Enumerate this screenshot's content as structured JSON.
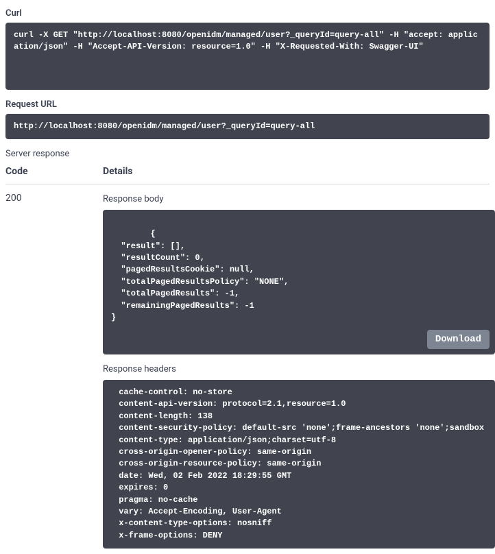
{
  "curl": {
    "label": "Curl",
    "command": "curl -X GET \"http://localhost:8080/openidm/managed/user?_queryId=query-all\" -H \"accept: application/json\" -H \"Accept-API-Version: resource=1.0\" -H \"X-Requested-With: Swagger-UI\""
  },
  "requestUrl": {
    "label": "Request URL",
    "url": "http://localhost:8080/openidm/managed/user?_queryId=query-all"
  },
  "serverResponse": {
    "label": "Server response",
    "headers": {
      "code": "Code",
      "details": "Details"
    },
    "response": {
      "code": "200",
      "bodyLabel": "Response body",
      "body": "{\n  \"result\": [],\n  \"resultCount\": 0,\n  \"pagedResultsCookie\": null,\n  \"totalPagedResultsPolicy\": \"NONE\",\n  \"totalPagedResults\": -1,\n  \"remainingPagedResults\": -1\n}",
      "downloadLabel": "Download",
      "headersLabel": "Response headers",
      "headers": " cache-control: no-store\n content-api-version: protocol=2.1,resource=1.0\n content-length: 138\n content-security-policy: default-src 'none';frame-ancestors 'none';sandbox\n content-type: application/json;charset=utf-8\n cross-origin-opener-policy: same-origin\n cross-origin-resource-policy: same-origin\n date: Wed, 02 Feb 2022 18:29:55 GMT\n expires: 0\n pragma: no-cache\n vary: Accept-Encoding, User-Agent\n x-content-type-options: nosniff\n x-frame-options: DENY"
    }
  }
}
